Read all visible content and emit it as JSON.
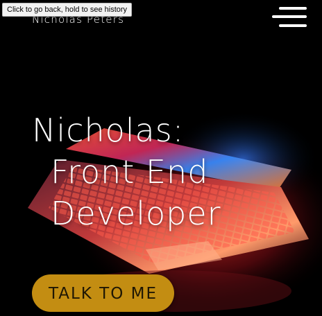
{
  "browser": {
    "tooltip": "Click to go back, hold to see history"
  },
  "header": {
    "site_name": "Nicholas Peters",
    "menu_icon": "hamburger-menu-icon"
  },
  "hero": {
    "title_line_1": "Nicholas:",
    "title_line_2": "Front End",
    "title_line_3": "Developer",
    "background_image": "laptop-with-glowing-keyboard",
    "cta_label": "TALK TO ME"
  },
  "colors": {
    "background": "#000000",
    "text": "#ffffff",
    "cta_background": "#c38d12",
    "cta_text": "#1f1704"
  }
}
